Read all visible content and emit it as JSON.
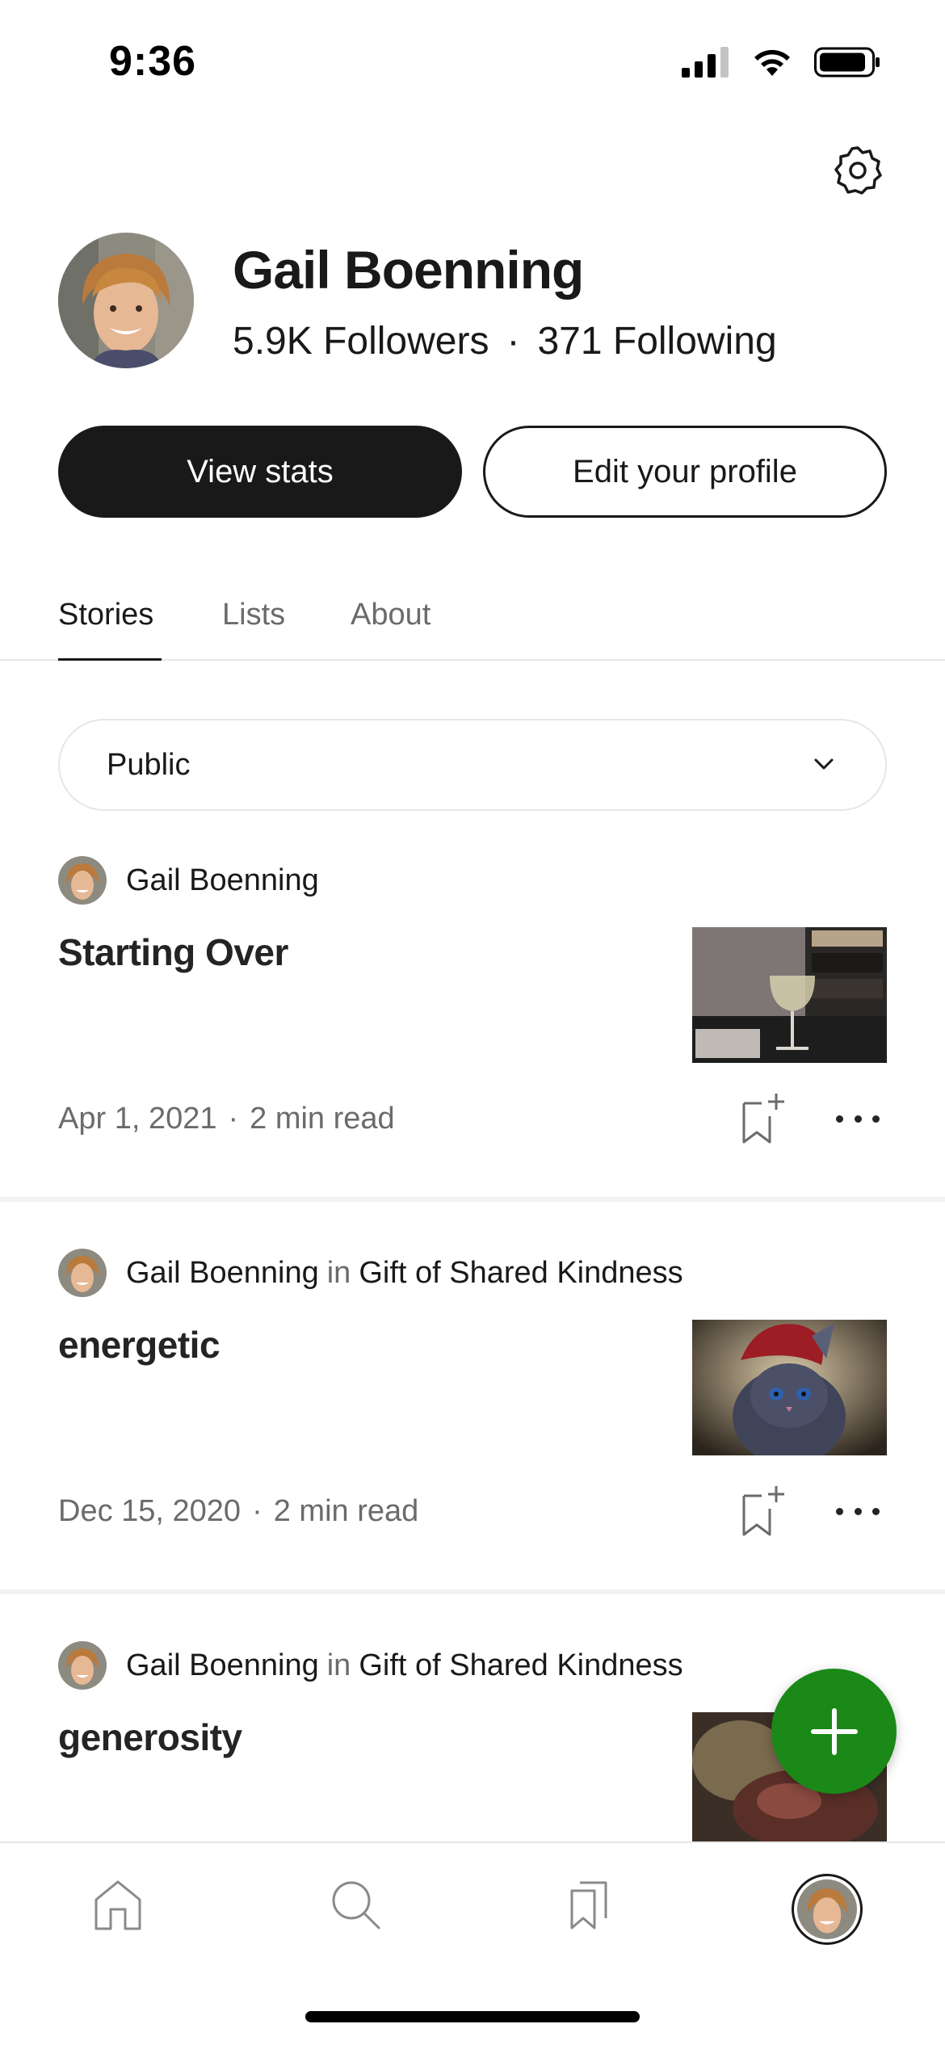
{
  "status_bar": {
    "time": "9:36",
    "icons": [
      "cellular-signal-icon",
      "wifi-icon",
      "battery-icon"
    ]
  },
  "header": {
    "settings_icon": "gear-icon"
  },
  "profile": {
    "name": "Gail Boenning",
    "followers": "5.9K Followers",
    "separator": "·",
    "following": "371 Following",
    "view_stats_label": "View stats",
    "edit_profile_label": "Edit your profile"
  },
  "tabs": [
    {
      "label": "Stories",
      "active": true
    },
    {
      "label": "Lists",
      "active": false
    },
    {
      "label": "About",
      "active": false
    }
  ],
  "filter": {
    "selected": "Public"
  },
  "stories": [
    {
      "author": "Gail Boenning",
      "in_word": "",
      "publication": "",
      "title": "Starting Over",
      "date": "Apr 1, 2021",
      "meta_sep": "·",
      "read_time": "2 min read",
      "thumb": "wine-glass-room"
    },
    {
      "author": "Gail Boenning",
      "in_word": "in",
      "publication": "Gift of Shared Kindness",
      "title": "energetic",
      "date": "Dec 15, 2020",
      "meta_sep": "·",
      "read_time": "2 min read",
      "thumb": "cat-red-hat"
    },
    {
      "author": "Gail Boenning",
      "in_word": "in",
      "publication": "Gift of Shared Kindness",
      "title": "generosity",
      "date": "",
      "meta_sep": "",
      "read_time": "",
      "thumb": "dark-still-life"
    }
  ],
  "fab": {
    "icon": "plus-icon"
  },
  "bottom_nav": {
    "items": [
      "home-icon",
      "search-icon",
      "bookmarks-icon",
      "profile-avatar"
    ]
  },
  "colors": {
    "primary_text": "#191919",
    "secondary_text": "#6b6b6b",
    "accent_green": "#1a8917",
    "divider": "#e6e6e6"
  }
}
